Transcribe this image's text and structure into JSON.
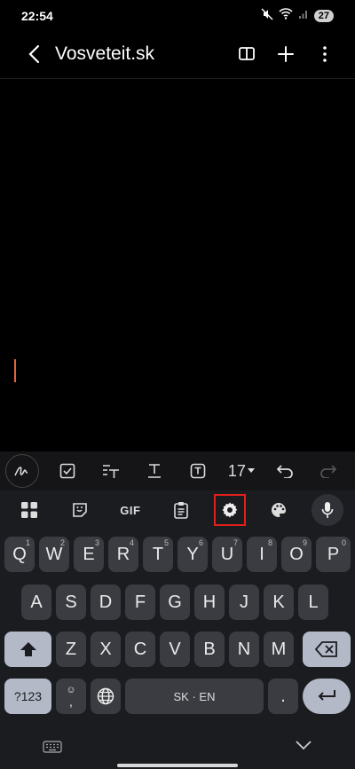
{
  "status": {
    "time": "22:54",
    "battery": "27"
  },
  "app": {
    "title": "Vosveteit.sk"
  },
  "format_bar": {
    "font_size": "17"
  },
  "keyboard": {
    "toolbar": {
      "gif_label": "GIF"
    },
    "rows": [
      [
        {
          "k": "Q",
          "h": "1"
        },
        {
          "k": "W",
          "h": "2"
        },
        {
          "k": "E",
          "h": "3"
        },
        {
          "k": "R",
          "h": "4"
        },
        {
          "k": "T",
          "h": "5"
        },
        {
          "k": "Y",
          "h": "6"
        },
        {
          "k": "U",
          "h": "7"
        },
        {
          "k": "I",
          "h": "8"
        },
        {
          "k": "O",
          "h": "9"
        },
        {
          "k": "P",
          "h": "0"
        }
      ],
      [
        {
          "k": "A"
        },
        {
          "k": "S"
        },
        {
          "k": "D"
        },
        {
          "k": "F"
        },
        {
          "k": "G"
        },
        {
          "k": "H"
        },
        {
          "k": "J"
        },
        {
          "k": "K"
        },
        {
          "k": "L"
        }
      ],
      [
        {
          "k": "Z"
        },
        {
          "k": "X"
        },
        {
          "k": "C"
        },
        {
          "k": "V"
        },
        {
          "k": "B"
        },
        {
          "k": "N"
        },
        {
          "k": "M"
        }
      ]
    ],
    "symbols_label": "?123",
    "comma_top": "☺",
    "comma_label": ",",
    "space_label": "SK · EN",
    "period_label": "."
  },
  "colors": {
    "caret": "#e2643a",
    "highlight": "#e0201b",
    "key": "#3b3c41",
    "key_special": "#b3b9c7"
  }
}
